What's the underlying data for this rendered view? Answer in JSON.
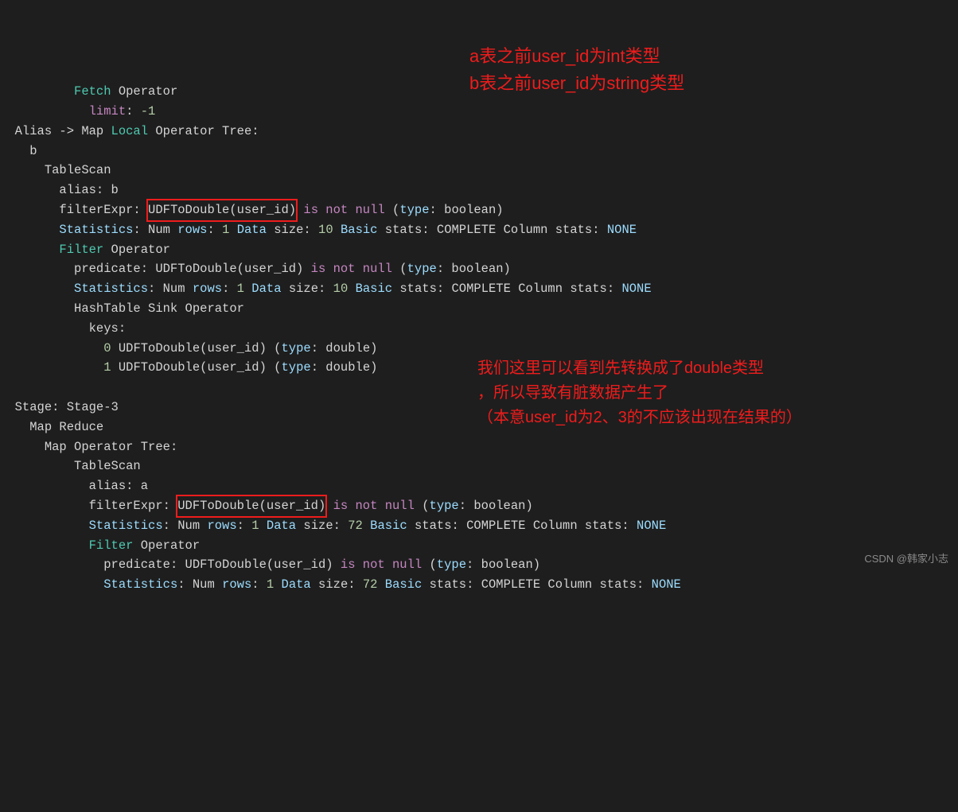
{
  "code": {
    "line01_fetch": "Fetch",
    "line01_operator": " Operator",
    "line02_limit": "limit",
    "line02_colon_val": ": ",
    "line02_val": "-1",
    "line03_a": "Alias -> Map ",
    "line03_local": "Local",
    "line03_b": " Operator Tree:",
    "line04": "b",
    "line05": "TableScan",
    "line06_a": "alias: b",
    "line07_a": "filterExpr: ",
    "line07_box": "UDFToDouble(user_id)",
    "line07_b": " ",
    "line07_isnotnull": "is not null",
    "line07_c": " (",
    "line07_type": "type",
    "line07_d": ": boolean)",
    "line08_a": "Statistics",
    "line08_b": ": Num ",
    "line08_rows": "rows",
    "line08_c": ": ",
    "line08_rows_v": "1",
    "line08_d": " ",
    "line08_data": "Data",
    "line08_e": " size: ",
    "line08_size_v": "10",
    "line08_f": " ",
    "line08_basic": "Basic",
    "line08_g": " stats: COMPLETE Column stats: ",
    "line08_none": "NONE",
    "line09_filter": "Filter",
    "line09_b": " Operator",
    "line10_a": "predicate: UDFToDouble(user_id) ",
    "line10_isnotnull": "is not null",
    "line10_b": " (",
    "line10_type": "type",
    "line10_c": ": boolean)",
    "line11_a": "Statistics",
    "line11_b": ": Num ",
    "line11_rows": "rows",
    "line11_c": ": ",
    "line11_rows_v": "1",
    "line11_d": " ",
    "line11_data": "Data",
    "line11_e": " size: ",
    "line11_size_v": "10",
    "line11_f": " ",
    "line11_basic": "Basic",
    "line11_g": " stats: COMPLETE Column stats: ",
    "line11_none": "NONE",
    "line12": "HashTable Sink Operator",
    "line13": "keys:",
    "line14_a": "0",
    "line14_b": " UDFToDouble(user_id) (",
    "line14_type": "type",
    "line14_c": ": double)",
    "line15_a": "1",
    "line15_b": " UDFToDouble(user_id) (",
    "line15_type": "type",
    "line15_c": ": double)",
    "line17": "Stage: Stage-3",
    "line18": "Map Reduce",
    "line19": "Map Operator Tree:",
    "line20": "TableScan",
    "line21": "alias: a",
    "line22_a": "filterExpr: ",
    "line22_box": "UDFToDouble(user_id)",
    "line22_b": " ",
    "line22_isnotnull": "is not null",
    "line22_c": " (",
    "line22_type": "type",
    "line22_d": ": boolean)",
    "line23_a": "Statistics",
    "line23_b": ": Num ",
    "line23_rows": "rows",
    "line23_c": ": ",
    "line23_rows_v": "1",
    "line23_d": " ",
    "line23_data": "Data",
    "line23_e": " size: ",
    "line23_size_v": "72",
    "line23_f": " ",
    "line23_basic": "Basic",
    "line23_g": " stats: COMPLETE Column stats: ",
    "line23_none": "NONE",
    "line24_filter": "Filter",
    "line24_b": " Operator",
    "line25_a": "predicate: UDFToDouble(user_id) ",
    "line25_isnotnull": "is not null",
    "line25_b": " (",
    "line25_type": "type",
    "line25_c": ": boolean)",
    "line26_a": "Statistics",
    "line26_b": ": Num ",
    "line26_rows": "rows",
    "line26_c": ": ",
    "line26_rows_v": "1",
    "line26_d": " ",
    "line26_data": "Data",
    "line26_e": " size: ",
    "line26_size_v": "72",
    "line26_f": " ",
    "line26_basic": "Basic",
    "line26_g": " stats: COMPLETE Column stats: ",
    "line26_none": "NONE"
  },
  "annotations": {
    "top1": "a表之前user_id为int类型",
    "top2": "b表之前user_id为string类型",
    "mid1": "我们这里可以看到先转换成了double类型",
    "mid2": "，所以导致有脏数据产生了",
    "mid3": "（本意user_id为2、3的不应该出现在结果的）"
  },
  "watermark": "CSDN @韩家小志"
}
